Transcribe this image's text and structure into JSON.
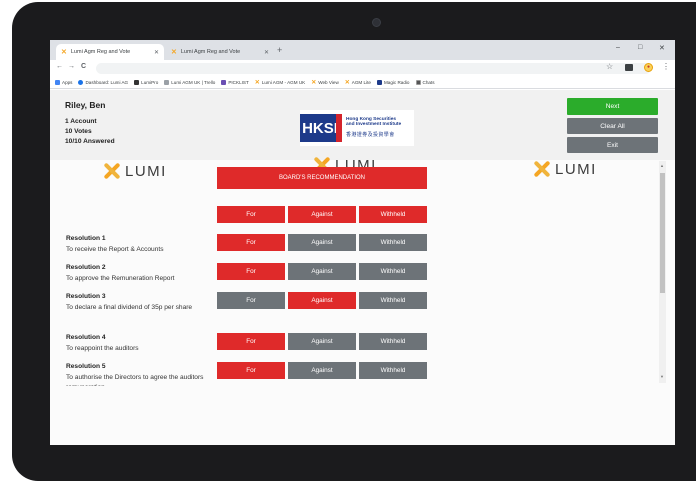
{
  "browser": {
    "tabs": [
      {
        "title": "Lumi Agm Reg and Vote",
        "close": "✕"
      },
      {
        "title": "Lumi Agm Reg and Vote",
        "close": "✕"
      }
    ],
    "new_tab": "+",
    "window_controls": [
      "–",
      "□",
      "✕"
    ],
    "nav": {
      "back": "←",
      "forward": "→",
      "reload": "C"
    },
    "bookmarks": [
      {
        "label": "Apps",
        "icon": "apps-grid-icon",
        "color": "#4285f4"
      },
      {
        "label": "Dashboard: Lumi AG",
        "icon": "cloud-icon",
        "color": "#1a73e8"
      },
      {
        "label": "LumiPro",
        "icon": "dark-square-icon",
        "color": "#333333"
      },
      {
        "label": "Lumi AGM UK | Trello",
        "icon": "trello-icon",
        "color": "#9aa0a6"
      },
      {
        "label": "PICKLIST",
        "icon": "purple-square-icon",
        "color": "#6a4fb3"
      },
      {
        "label": "Lumi AGM - AGM UK",
        "icon": "lumi-x-icon",
        "color": "#f5a623"
      },
      {
        "label": "Web View",
        "icon": "lumi-x-icon",
        "color": "#f5a623"
      },
      {
        "label": "AGM Lite",
        "icon": "lumi-x-icon",
        "color": "#f5a623"
      },
      {
        "label": "Magic Radio",
        "icon": "radio-icon",
        "color": "#1d3a8a"
      },
      {
        "label": "Chats",
        "icon": "chat-icon",
        "color": "#555555"
      }
    ]
  },
  "header": {
    "user_name": "Riley, Ben",
    "accounts": "1 Account",
    "votes": "10 Votes",
    "answered": "10/10 Answered",
    "logo": {
      "mark": "HKSI",
      "line1": "Hong Kong Securities",
      "line2": "and Investment Institute",
      "chinese": "香港證券及投資學會"
    },
    "buttons": {
      "next": "Next",
      "clear_all": "Clear All",
      "exit": "Exit"
    }
  },
  "brand": {
    "name": "LUMI"
  },
  "board_recommendation": {
    "label": "BOARD'S RECOMMENDATION",
    "options": [
      "For",
      "Against",
      "Withheld"
    ]
  },
  "resolutions": [
    {
      "title": "Resolution 1",
      "description": "To receive the Report & Accounts",
      "selected": "For"
    },
    {
      "title": "Resolution 2",
      "description": "To approve the Remuneration Report",
      "selected": "For"
    },
    {
      "title": "Resolution 3",
      "description": "To declare a final dividend of 35p per share",
      "selected": "Against"
    },
    {
      "title": "Resolution 4",
      "description": "To reappoint the auditors",
      "selected": "For"
    },
    {
      "title": "Resolution 5",
      "description": "To authorise the Directors to agree the auditors remuneration",
      "selected": "For"
    }
  ],
  "vote_options": [
    "For",
    "Against",
    "Withheld"
  ],
  "colors": {
    "selected": "#df2a2a",
    "unselected": "#6d7378",
    "next": "#2bac2b",
    "accent": "#f5a623"
  }
}
